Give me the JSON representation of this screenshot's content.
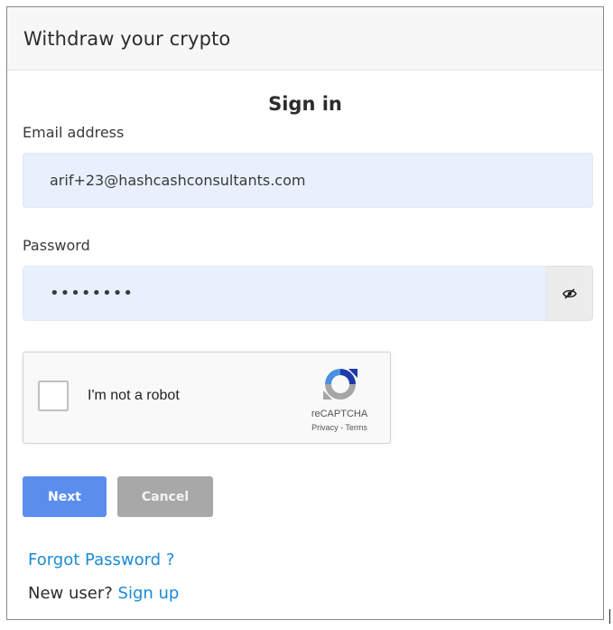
{
  "header": {
    "title": "Withdraw your crypto"
  },
  "form": {
    "heading": "Sign in",
    "email": {
      "label": "Email address",
      "value": "arif+23@hashcashconsultants.com"
    },
    "password": {
      "label": "Password",
      "value": "••••••••",
      "toggle_icon": "eye-slash-icon"
    },
    "captcha": {
      "checkbox_label": "I'm not a robot",
      "brand": "reCAPTCHA",
      "privacy": "Privacy",
      "separator": " - ",
      "terms": "Terms",
      "icon": "recaptcha-logo-icon"
    },
    "buttons": {
      "next": "Next",
      "cancel": "Cancel"
    },
    "links": {
      "forgot": "Forgot Password ?",
      "new_user_prefix": "New user? ",
      "sign_up": "Sign up"
    }
  },
  "colors": {
    "primary": "#5b8def",
    "secondary": "#a8a8a8",
    "link": "#1a8ad6",
    "input_bg": "#e8f0fe"
  }
}
